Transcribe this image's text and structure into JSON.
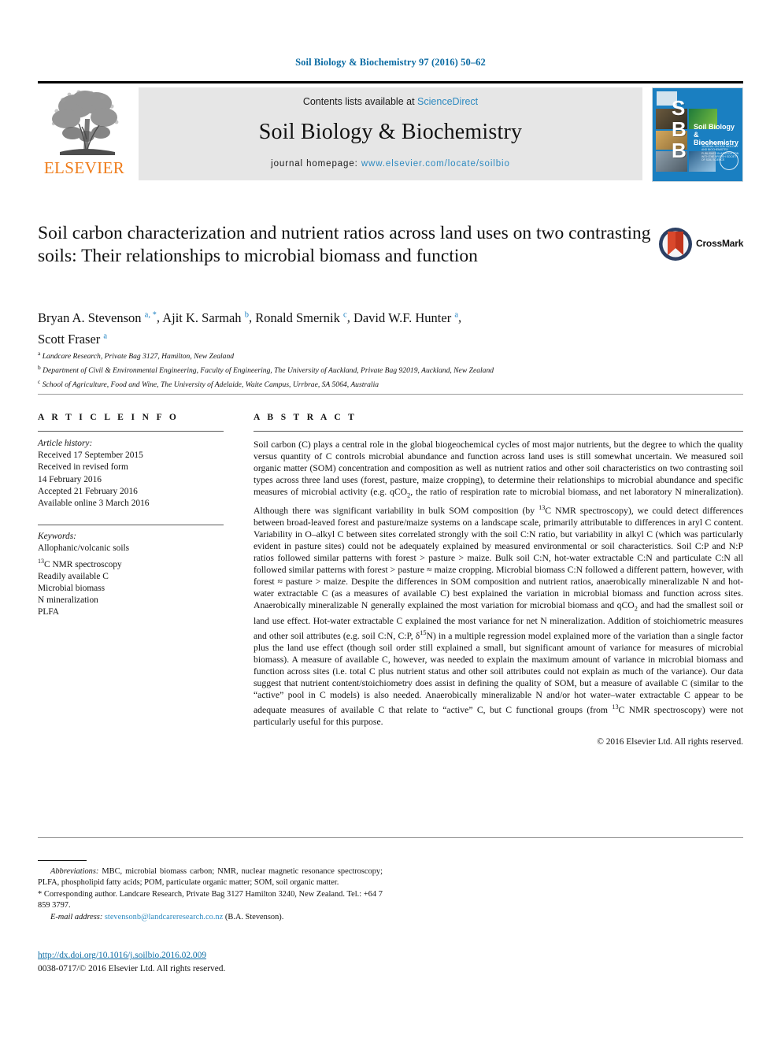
{
  "running_head": "Soil Biology & Biochemistry 97 (2016) 50–62",
  "masthead": {
    "contents_prefix": "Contents lists available at",
    "sciencedirect_label": "ScienceDirect",
    "journal_title": "Soil Biology & Biochemistry",
    "homepage_prefix": "journal homepage:",
    "homepage_url": "www.elsevier.com/locate/soilbio",
    "publisher_wordmark": "ELSEVIER",
    "publisher_color": "#ef7c1a",
    "band_color": "#e6e6e6",
    "link_color": "#2e8ac0",
    "cover": {
      "initials": "S\nB\nB",
      "journal_name": "Soil Biology & Biochemistry",
      "blurb": "AN INTERNATIONAL JOURNAL ON SOIL BIOLOGY AND BIOCHEMISTRY PUBLISHED IN ASSOCIATION WITH THE BRITISH SOCIETY OF SOIL SCIENCE",
      "background_color": "#1a7fc1"
    }
  },
  "article": {
    "title": "Soil carbon characterization and nutrient ratios across land uses on two contrasting soils: Their relationships to microbial biomass and function",
    "crossmark_label": "CrossMark",
    "authors": [
      {
        "name": "Bryan A. Stevenson",
        "marks": "a, *"
      },
      {
        "name": "Ajit K. Sarmah",
        "marks": "b"
      },
      {
        "name": "Ronald Smernik",
        "marks": "c"
      },
      {
        "name": "David W.F. Hunter",
        "marks": "a"
      },
      {
        "name": "Scott Fraser",
        "marks": "a"
      }
    ],
    "affiliations": [
      {
        "mark": "a",
        "text": "Landcare Research, Private Bag 3127, Hamilton, New Zealand"
      },
      {
        "mark": "b",
        "text": "Department of Civil & Environmental Engineering, Faculty of Engineering, The University of Auckland, Private Bag 92019, Auckland, New Zealand"
      },
      {
        "mark": "c",
        "text": "School of Agriculture, Food and Wine, The University of Adelaide, Waite Campus, Urrbrae, SA 5064, Australia"
      }
    ]
  },
  "article_info": {
    "heading": "A R T I C L E  I N F O",
    "history_label": "Article history:",
    "history_lines": [
      "Received 17 September 2015",
      "Received in revised form",
      "14 February 2016",
      "Accepted 21 February 2016",
      "Available online 3 March 2016"
    ],
    "keywords_label": "Keywords:",
    "keywords": [
      "Allophanic/volcanic soils",
      "13C NMR spectroscopy",
      "Readily available C",
      "Microbial biomass",
      "N mineralization",
      "PLFA"
    ]
  },
  "abstract": {
    "heading": "A B S T R A C T",
    "paragraph": "Soil carbon (C) plays a central role in the global biogeochemical cycles of most major nutrients, but the degree to which the quality versus quantity of C controls microbial abundance and function across land uses is still somewhat uncertain. We measured soil organic matter (SOM) concentration and composition as well as nutrient ratios and other soil characteristics on two contrasting soil types across three land uses (forest, pasture, maize cropping), to determine their relationships to microbial abundance and specific measures of microbial activity (e.g. qCO2, the ratio of respiration rate to microbial biomass, and net laboratory N mineralization). Although there was significant variability in bulk SOM composition (by 13C NMR spectroscopy), we could detect differences between broad-leaved forest and pasture/maize systems on a landscape scale, primarily attributable to differences in aryl C content. Variability in O–alkyl C between sites correlated strongly with the soil C:N ratio, but variability in alkyl C (which was particularly evident in pasture sites) could not be adequately explained by measured environmental or soil characteristics. Soil C:P and N:P ratios followed similar patterns with forest > pasture > maize. Bulk soil C:N, hot-water extractable C:N and particulate C:N all followed similar patterns with forest > pasture ≈ maize cropping. Microbial biomass C:N followed a different pattern, however, with forest ≈ pasture > maize. Despite the differences in SOM composition and nutrient ratios, anaerobically mineralizable N and hot-water extractable C (as a measures of available C) best explained the variation in microbial biomass and function across sites. Anaerobically mineralizable N generally explained the most variation for microbial biomass and qCO2 and had the smallest soil or land use effect. Hot-water extractable C explained the most variance for net N mineralization. Addition of stoichiometric measures and other soil attributes (e.g. soil C:N, C:P, δ15N) in a multiple regression model explained more of the variation than a single factor plus the land use effect (though soil order still explained a small, but significant amount of variance for measures of microbial biomass). A measure of available C, however, was needed to explain the maximum amount of variance in microbial biomass and function across sites (i.e. total C plus nutrient status and other soil attributes could not explain as much of the variance). Our data suggest that nutrient content/stoichiometry does assist in defining the quality of SOM, but a measure of available C (similar to the “active” pool in C models) is also needed. Anaerobically mineralizable N and/or hot water–water extractable C appear to be adequate measures of available C that relate to “active” C, but C functional groups (from 13C NMR spectroscopy) were not particularly useful for this purpose.",
    "copyright": "© 2016 Elsevier Ltd. All rights reserved."
  },
  "footnotes": {
    "abbreviations_label": "Abbreviations:",
    "abbreviations_text": "MBC, microbial biomass carbon; NMR, nuclear magnetic resonance spectroscopy; PLFA, phospholipid fatty acids; POM, particulate organic matter; SOM, soil organic matter.",
    "corresponding_text": "* Corresponding author. Landcare Research, Private Bag 3127 Hamilton 3240, New Zealand. Tel.: +64 7 859 3797.",
    "email_label": "E-mail address:",
    "email_address": "stevensonb@landcareresearch.co.nz",
    "email_owner": "(B.A. Stevenson)."
  },
  "footer": {
    "doi_url": "http://dx.doi.org/10.1016/j.soilbio.2016.02.009",
    "issn_line": "0038-0717/© 2016 Elsevier Ltd. All rights reserved."
  }
}
